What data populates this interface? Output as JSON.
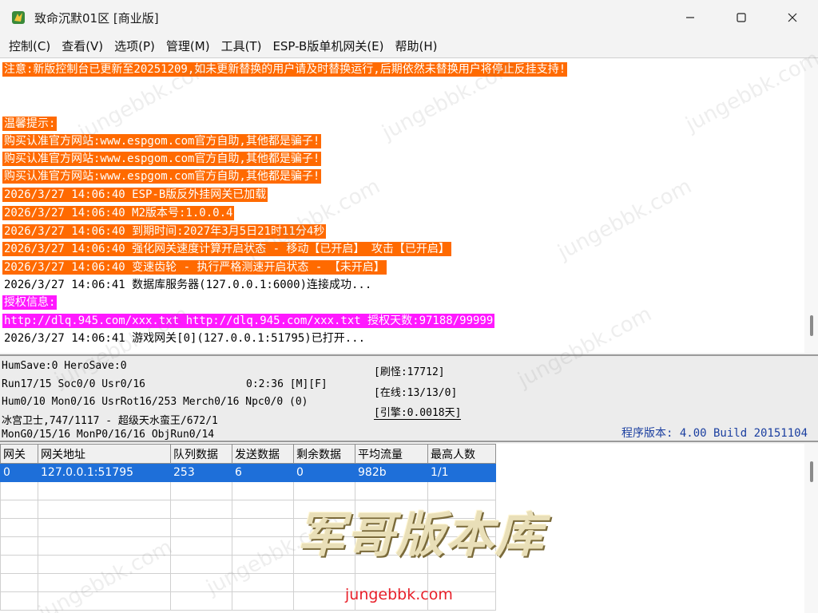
{
  "window": {
    "title": "致命沉默01区 [商业版]",
    "controls": [
      "minimize-icon",
      "maximize-icon",
      "close-icon"
    ]
  },
  "menu": [
    {
      "label": "控制(C)"
    },
    {
      "label": "查看(V)"
    },
    {
      "label": "选项(P)"
    },
    {
      "label": "管理(M)"
    },
    {
      "label": "工具(T)"
    },
    {
      "label": "ESP-B版单机网关(E)"
    },
    {
      "label": "帮助(H)"
    }
  ],
  "log": {
    "lines": [
      {
        "text": "注意:新版控制台已更新至20251209,如未更新替换的用户请及时替换运行,后期依然未替换用户将停止反挂支持!",
        "bg": "#ff6a00"
      },
      {
        "text": "温馨提示:",
        "bg": "#ff6a00"
      },
      {
        "text": "购买认准官方网站:www.espgom.com官方自助,其他都是骗子!",
        "bg": "#ff6a00"
      },
      {
        "text": "购买认准官方网站:www.espgom.com官方自助,其他都是骗子!",
        "bg": "#ff6a00"
      },
      {
        "text": "购买认准官方网站:www.espgom.com官方自助,其他都是骗子!",
        "bg": "#ff6a00"
      },
      {
        "text": "2026/3/27 14:06:40 ESP-B版反外挂网关已加载",
        "bg": "#ff6a00"
      },
      {
        "text": "2026/3/27 14:06:40 M2版本号:1.0.0.4",
        "bg": "#ff6a00"
      },
      {
        "text": "2026/3/27 14:06:40 到期时间:2027年3月5日21时11分4秒",
        "bg": "#ff6a00"
      },
      {
        "text": "2026/3/27 14:06:40 强化网关速度计算开启状态 - 移动【已开启】 攻击【已开启】",
        "bg": "#ff6a00"
      },
      {
        "text": "2026/3/27 14:06:40 变速齿轮 - 执行严格测速开启状态 - 【未开启】",
        "bg": "#ff6a00"
      },
      {
        "text": "2026/3/27 14:06:41 数据库服务器(127.0.0.1:6000)连接成功...",
        "bg": ""
      },
      {
        "text": "授权信息:",
        "bg": "#ff19ff"
      },
      {
        "text": "http://dlq.945.com/xxx.txt http://dlq.945.com/xxx.txt 授权天数:97188/99999",
        "bg": "#ff19ff"
      },
      {
        "text": "2026/3/27 14:06:41 游戏网关[0](127.0.0.1:51795)已打开...",
        "bg": ""
      }
    ]
  },
  "status": {
    "save": "HumSave:0 HeroSave:0",
    "run": "Run17/15 Soc0/0 Usr0/16",
    "timer": "0:2:36 [M][F]",
    "hum": "Hum0/10 Mon0/16 UsrRot16/253 Merch0/16 Npc0/0 (0)",
    "boss": "冰宫卫士,747/1117 - 超级天水蛮王/672/1",
    "mon": "MonG0/15/16 MonP0/16/16 ObjRun0/14",
    "refresh": "[刷怪:17712]",
    "online": "[在线:13/13/0]",
    "engine": "[引擎:0.0018天]",
    "version": "程序版本: 4.00 Build 20151104"
  },
  "grid": {
    "columns": [
      "网关",
      "网关地址",
      "队列数据",
      "发送数据",
      "剩余数据",
      "平均流量",
      "最高人数"
    ],
    "rows": [
      [
        "0",
        "127.0.0.1:51795",
        "253",
        "6",
        "0",
        "982b",
        "1/1"
      ]
    ],
    "empty_rows": 7
  },
  "watermark": {
    "text": "jungebbk.com",
    "logo": "军哥版本库",
    "url": "jungebbk.com"
  },
  "colors": {
    "orange_highlight": "#ff6a00",
    "magenta_highlight": "#ff19ff",
    "selection": "#1e6fd9",
    "version_text": "#1b3fa0"
  }
}
